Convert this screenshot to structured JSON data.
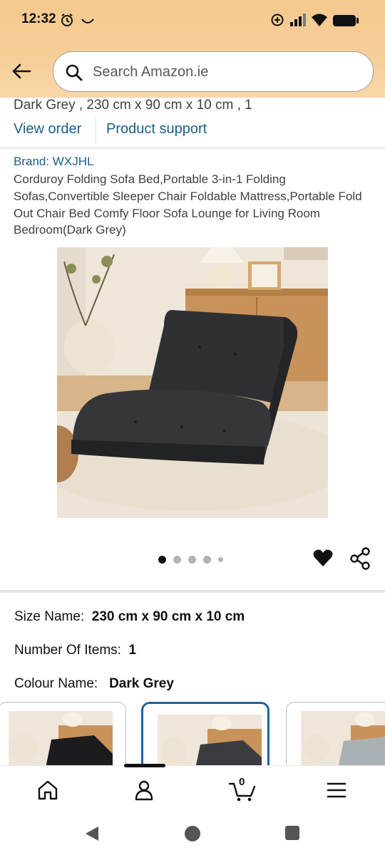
{
  "status_bar": {
    "time": "12:32",
    "icons": [
      "alarm-icon",
      "smile-icon",
      "data-saver-icon",
      "signal-icon",
      "wifi-icon",
      "battery-icon"
    ]
  },
  "header": {
    "search_placeholder": "Search Amazon.ie",
    "background_color": "#f6cf98"
  },
  "order": {
    "variant_line": "Dark Grey , 230 cm x 90 cm x 10 cm , 1",
    "view_order_label": "View order",
    "product_support_label": "Product support"
  },
  "product": {
    "brand": "Brand: WXJHL",
    "title": "Corduroy Folding Sofa Bed,Portable 3-in-1 Folding Sofas,Convertible Sleeper Chair Foldable Mattress,Portable Fold Out Chair Bed Comfy Floor Sofa Lounge for Living Room Bedroom(Dark Grey)",
    "image_count": 5,
    "active_image": 1
  },
  "attributes": {
    "size_label": "Size Name:",
    "size_value": "230 cm x 90 cm x 10 cm",
    "items_label": "Number Of Items:",
    "items_value": "1",
    "colour_label": "Colour Name:",
    "colour_value": "Dark Grey"
  },
  "colour_options": [
    {
      "name": "black",
      "color": "#1c1c1e",
      "selected": false
    },
    {
      "name": "dark-grey",
      "color": "#3a3c40",
      "selected": true
    },
    {
      "name": "light-grey",
      "color": "#a9b1b5",
      "selected": false
    }
  ],
  "bottom_nav": {
    "items": [
      "home-icon",
      "account-icon",
      "cart-icon",
      "menu-icon"
    ],
    "cart_count": "0"
  },
  "accent": {
    "link_color": "#1b5f8a",
    "selected_border": "#2162a1"
  }
}
